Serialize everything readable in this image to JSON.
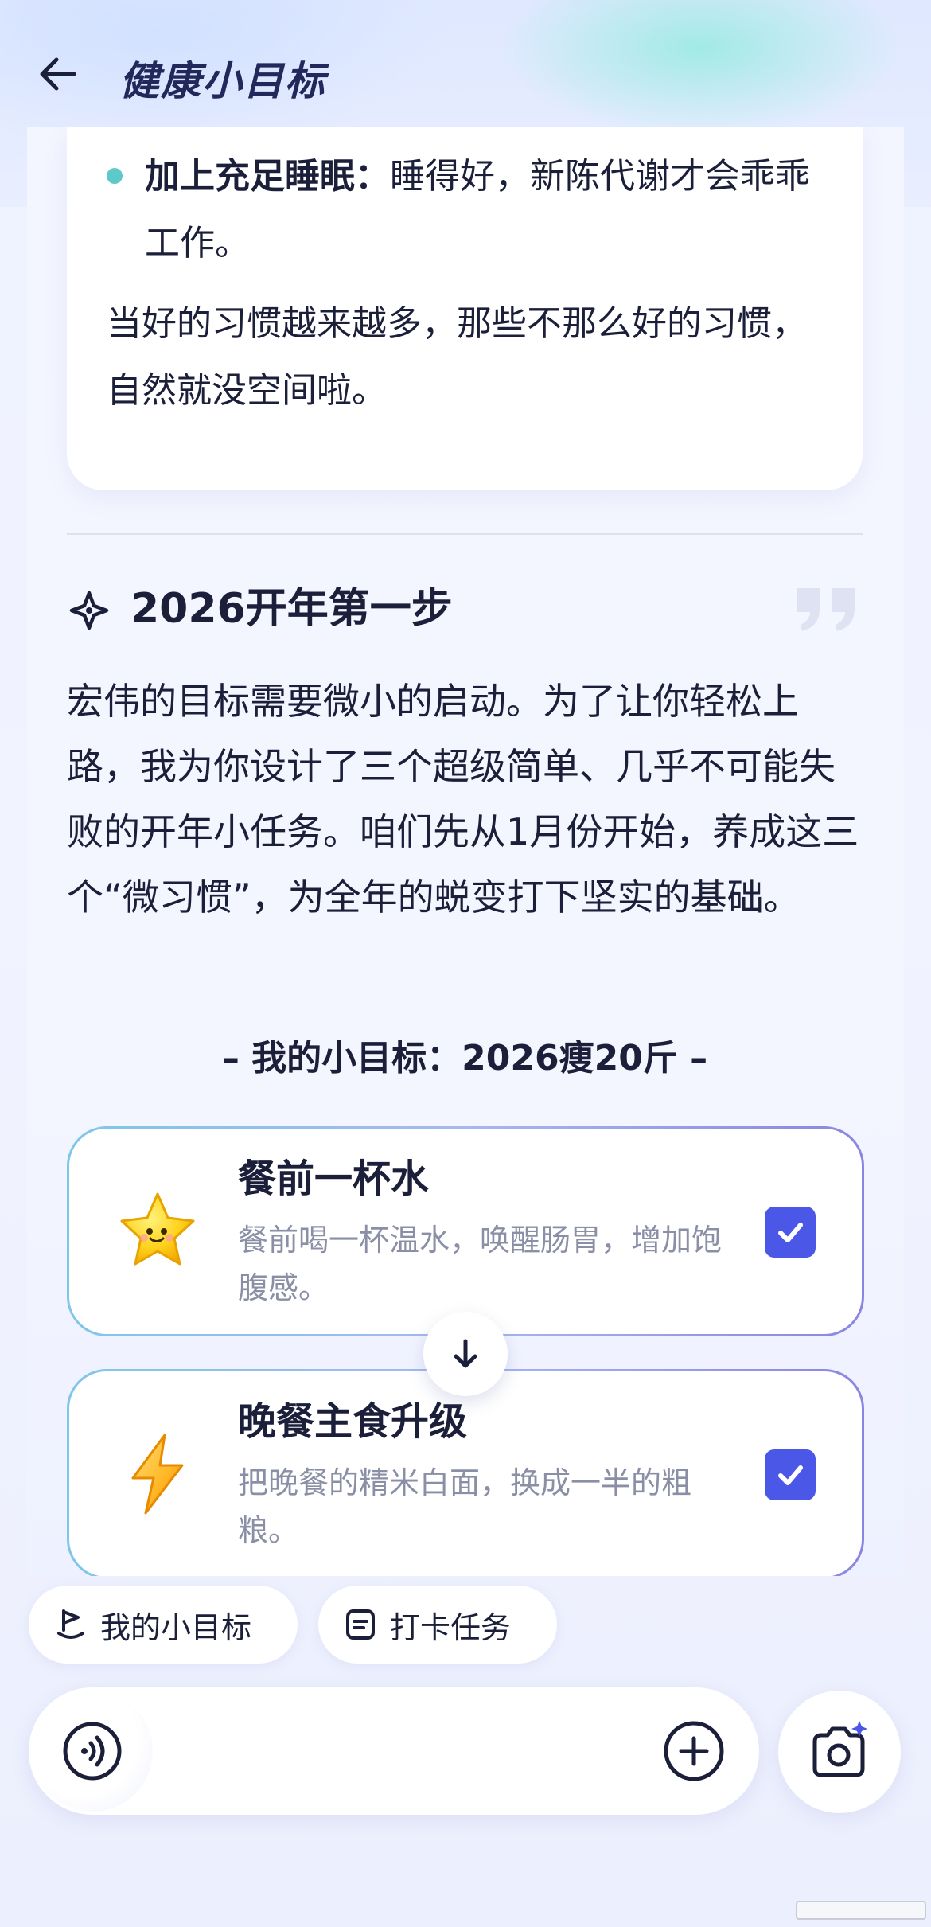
{
  "header": {
    "title": "健康小目标",
    "back_icon": "arrow-left-icon"
  },
  "prev_card": {
    "bullet_label": "加上充足睡眠：",
    "bullet_text": "睡得好，新陈代谢才会乖乖工作。",
    "closing": "当好的习惯越来越多，那些不那么好的习惯，自然就没空间啦。"
  },
  "section": {
    "title": "2026开年第一步",
    "icon": "sparkle-icon",
    "intro": "宏伟的目标需要微小的启动。为了让你轻松上路，我为你设计了三个超级简单、几乎不可能失败的开年小任务。咱们先从1月份开始，养成这三个“微习惯”，为全年的蜕变打下坚实的基础。",
    "goal_caption": "– 我的小目标：2026瘦20斤 –"
  },
  "tasks": [
    {
      "title": "餐前一杯水",
      "desc": "餐前喝一杯温水，唤醒肠胃，增加饱腹感。",
      "icon": "star-icon",
      "checked": true
    },
    {
      "title": "晚餐主食升级",
      "desc": "把晚餐的精米白面，换成一半的粗粮。",
      "icon": "lightning-icon",
      "checked": true
    }
  ],
  "chips": [
    {
      "label": "我的小目标",
      "icon": "flag-icon"
    },
    {
      "label": "打卡任务",
      "icon": "clipboard-icon"
    }
  ],
  "input": {
    "voice_icon": "voice-icon",
    "plus_icon": "plus-icon",
    "camera_icon": "camera-icon"
  },
  "colors": {
    "accent": "#4b57e6",
    "bullet": "#5ec9c9",
    "text": "#1b1f3a",
    "muted": "#8a8fa6"
  }
}
